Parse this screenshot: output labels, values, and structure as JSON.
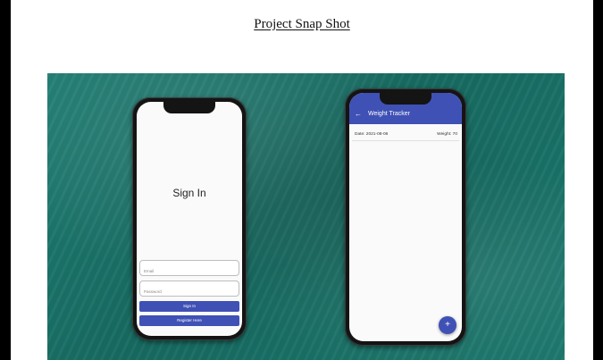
{
  "document": {
    "title": "Project Snap Shot"
  },
  "signin_screen": {
    "heading": "Sign In",
    "email_placeholder": "Email",
    "password_placeholder": "Password",
    "signin_button": "Sign In",
    "register_button": "Register Here",
    "accent_color": "#3f51b5"
  },
  "tracker_screen": {
    "title": "Weight Tracker",
    "back_icon": "arrow-left-icon",
    "entries": [
      {
        "date": "Date: 2021-08-06",
        "weight": "Weight: 70"
      }
    ],
    "fab_icon": "plus-icon",
    "fab_label": "+"
  },
  "colors": {
    "banner": "#1b766b",
    "app_primary": "#3f51b5"
  }
}
